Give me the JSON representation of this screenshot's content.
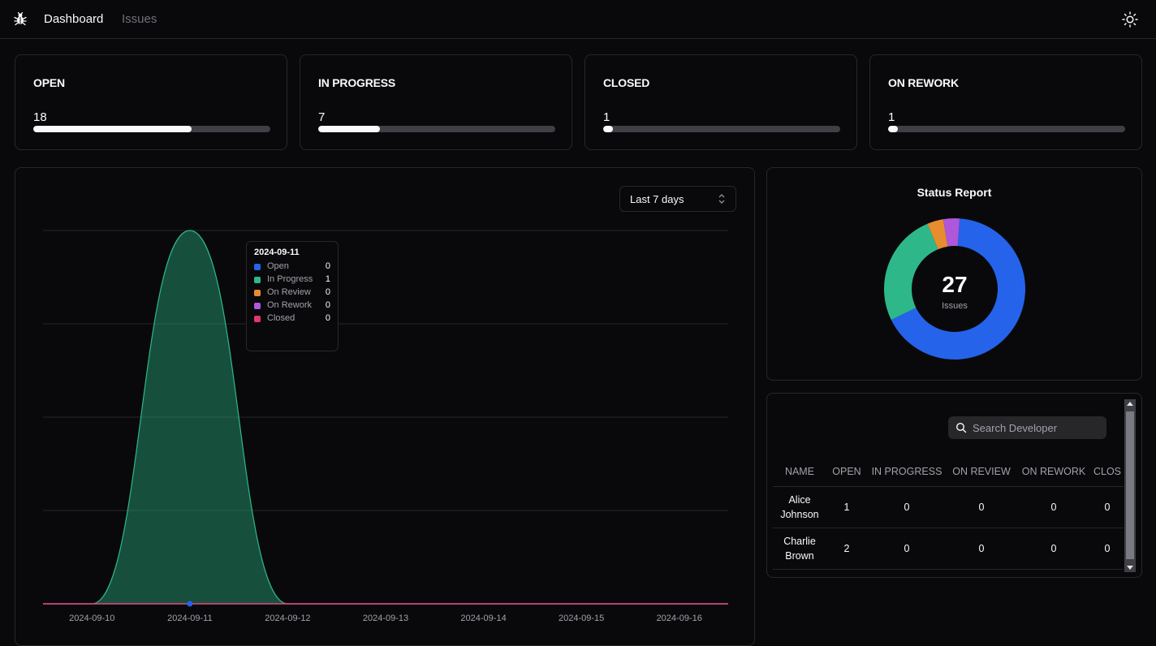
{
  "nav": {
    "dashboard": "Dashboard",
    "issues": "Issues"
  },
  "icons": {
    "logo": "bug-icon",
    "theme": "sun-icon",
    "search": "search-icon",
    "select": "chevron-up-down-icon"
  },
  "stats": [
    {
      "title": "OPEN",
      "value": "18",
      "progress": 0.667
    },
    {
      "title": "IN PROGRESS",
      "value": "7",
      "progress": 0.26
    },
    {
      "title": "CLOSED",
      "value": "1",
      "progress": 0.04
    },
    {
      "title": "ON REWORK",
      "value": "1",
      "progress": 0.04
    }
  ],
  "range_select": {
    "value": "Last 7 days"
  },
  "chart_data": {
    "type": "area",
    "x": [
      "2024-09-10",
      "2024-09-11",
      "2024-09-12",
      "2024-09-13",
      "2024-09-14",
      "2024-09-15",
      "2024-09-16"
    ],
    "series": [
      {
        "name": "Open",
        "values": [
          0,
          0,
          0,
          0,
          0,
          0,
          0
        ]
      },
      {
        "name": "In Progress",
        "values": [
          0,
          1,
          0,
          0,
          0,
          0,
          0
        ]
      },
      {
        "name": "On Review",
        "values": [
          0,
          0,
          0,
          0,
          0,
          0,
          0
        ]
      },
      {
        "name": "On Rework",
        "values": [
          0,
          0,
          0,
          0,
          0,
          0,
          0
        ]
      },
      {
        "name": "Closed",
        "values": [
          0,
          0,
          0,
          0,
          0,
          0,
          0
        ]
      }
    ],
    "ylim": [
      0,
      1
    ],
    "grid": true,
    "tooltip": {
      "title": "2024-09-11",
      "rows": [
        {
          "label": "Open",
          "value": "0",
          "color": "#2563eb"
        },
        {
          "label": "In Progress",
          "value": "1",
          "color": "#2eb88a"
        },
        {
          "label": "On Review",
          "value": "0",
          "color": "#e88c30"
        },
        {
          "label": "On Rework",
          "value": "0",
          "color": "#af57db"
        },
        {
          "label": "Closed",
          "value": "0",
          "color": "#e23670"
        }
      ]
    }
  },
  "status_report": {
    "title": "Status Report",
    "total": "27",
    "total_label": "Issues",
    "segments": [
      {
        "name": "Open",
        "value": 18,
        "color": "#2563eb"
      },
      {
        "name": "In Progress",
        "value": 7,
        "color": "#2eb88a"
      },
      {
        "name": "On Review",
        "value": 1,
        "color": "#e88c30"
      },
      {
        "name": "On Rework",
        "value": 1,
        "color": "#af57db"
      }
    ]
  },
  "developers": {
    "search_placeholder": "Search Developer",
    "columns": [
      "NAME",
      "OPEN",
      "IN PROGRESS",
      "ON REVIEW",
      "ON REWORK",
      "CLOS"
    ],
    "rows": [
      {
        "name": "Alice Johnson",
        "open": "1",
        "in_progress": "0",
        "on_review": "0",
        "on_rework": "0",
        "closed": "0"
      },
      {
        "name": "Charlie Brown",
        "open": "2",
        "in_progress": "0",
        "on_review": "0",
        "on_rework": "0",
        "closed": "0"
      }
    ]
  }
}
